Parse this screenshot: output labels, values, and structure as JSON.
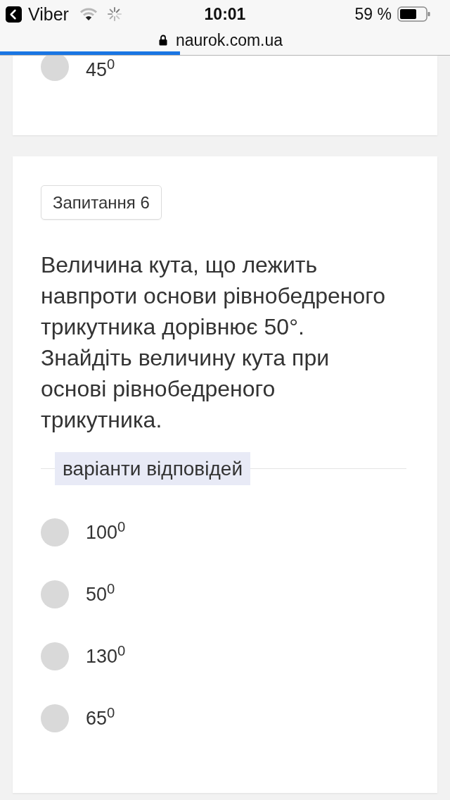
{
  "status_bar": {
    "back_label": "Viber",
    "time": "10:01",
    "battery": "59 %"
  },
  "address_bar": {
    "url": "naurok.com.ua",
    "page_load": {
      "level": 0.4
    }
  },
  "previous_question": {
    "options": [
      {
        "text": "45$^{0}$",
        "selected": false
      }
    ]
  },
  "question": {
    "badge": "Запитання 6",
    "paragraphs": [
      "Величина кута, що лежить навпроти основи рівнобедреного трикутника дорівнює 50°.",
      "Знайдіть величину кута при основі рівнобедреного трикутника."
    ],
    "answers_heading": "варіанти відповідей",
    "options": [
      {
        "text": "100$^{0}$",
        "selected": false
      },
      {
        "text": "50$^{0}$",
        "selected": false
      },
      {
        "text": "130$^{0}$",
        "selected": false
      },
      {
        "text": "65$^{0}$",
        "selected": false
      }
    ]
  }
}
